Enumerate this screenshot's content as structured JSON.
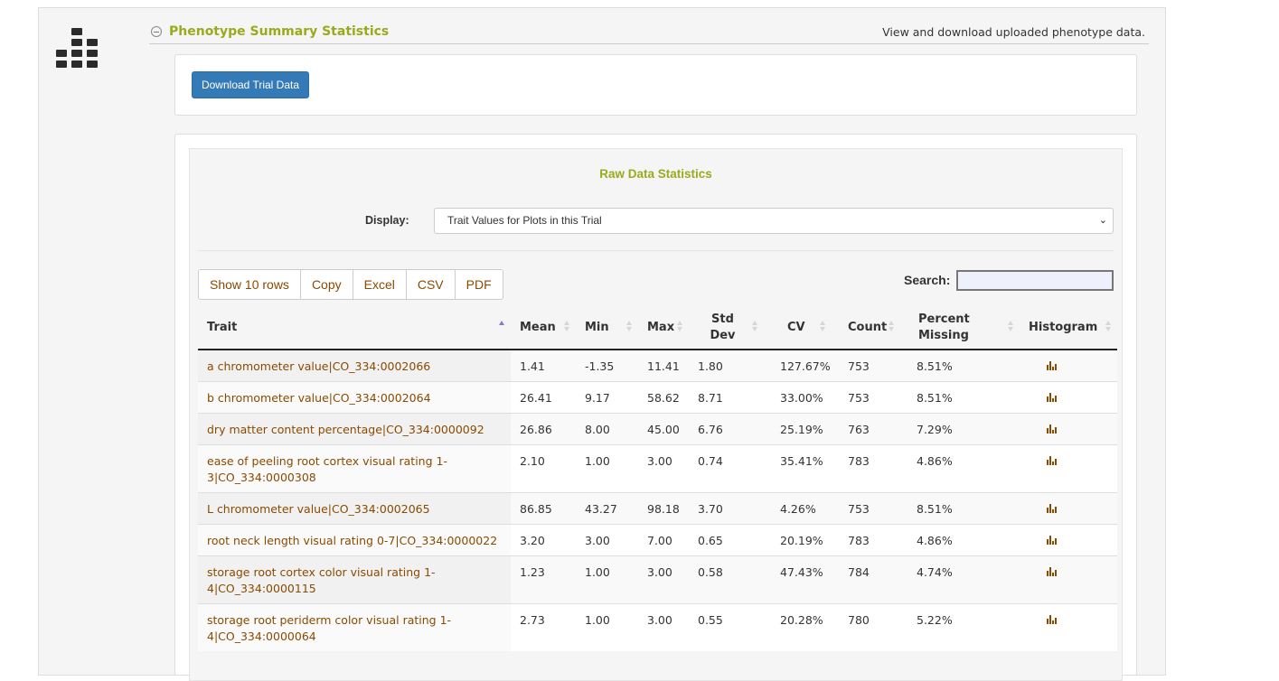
{
  "section": {
    "title": "Phenotype Summary Statistics",
    "description": "View and download uploaded phenotype data."
  },
  "download_button": "Download Trial Data",
  "stats_panel": {
    "title": "Raw Data Statistics",
    "display_label": "Display:",
    "display_value": "Trait Values for Plots in this Trial"
  },
  "toolbar": {
    "buttons": [
      "Show 10 rows",
      "Copy",
      "Excel",
      "CSV",
      "PDF"
    ],
    "search_label": "Search:"
  },
  "table": {
    "headers": {
      "trait": "Trait",
      "mean": "Mean",
      "min": "Min",
      "max": "Max",
      "std_dev_1": "Std",
      "std_dev_2": "Dev",
      "cv": "CV",
      "count": "Count",
      "missing_1": "Percent",
      "missing_2": "Missing",
      "histogram": "Histogram"
    },
    "rows": [
      {
        "trait": "a chromometer value|CO_334:0002066",
        "mean": "1.41",
        "min": "-1.35",
        "max": "11.41",
        "std": "1.80",
        "cv": "127.67%",
        "count": "753",
        "missing": "8.51%"
      },
      {
        "trait": "b chromometer value|CO_334:0002064",
        "mean": "26.41",
        "min": "9.17",
        "max": "58.62",
        "std": "8.71",
        "cv": "33.00%",
        "count": "753",
        "missing": "8.51%"
      },
      {
        "trait": "dry matter content percentage|CO_334:0000092",
        "mean": "26.86",
        "min": "8.00",
        "max": "45.00",
        "std": "6.76",
        "cv": "25.19%",
        "count": "763",
        "missing": "7.29%"
      },
      {
        "trait": "ease of peeling root cortex visual rating 1-3|CO_334:0000308",
        "mean": "2.10",
        "min": "1.00",
        "max": "3.00",
        "std": "0.74",
        "cv": "35.41%",
        "count": "783",
        "missing": "4.86%"
      },
      {
        "trait": "L chromometer value|CO_334:0002065",
        "mean": "86.85",
        "min": "43.27",
        "max": "98.18",
        "std": "3.70",
        "cv": "4.26%",
        "count": "753",
        "missing": "8.51%"
      },
      {
        "trait": "root neck length visual rating 0-7|CO_334:0000022",
        "mean": "3.20",
        "min": "3.00",
        "max": "7.00",
        "std": "0.65",
        "cv": "20.19%",
        "count": "783",
        "missing": "4.86%"
      },
      {
        "trait": "storage root cortex color visual rating 1-4|CO_334:0000115",
        "mean": "1.23",
        "min": "1.00",
        "max": "3.00",
        "std": "0.58",
        "cv": "47.43%",
        "count": "784",
        "missing": "4.74%"
      },
      {
        "trait": "storage root periderm color visual rating 1-4|CO_334:0000064",
        "mean": "2.73",
        "min": "1.00",
        "max": "3.00",
        "std": "0.55",
        "cv": "20.28%",
        "count": "780",
        "missing": "5.22%"
      }
    ]
  },
  "colors": {
    "accent_green": "#9aaa1a",
    "link_brown": "#8a4a00",
    "button_blue": "#337ab7"
  },
  "icons": {
    "section": "table-sections-icon",
    "collapse": "collapse-minus-icon",
    "histogram": "bar-chart-icon"
  }
}
